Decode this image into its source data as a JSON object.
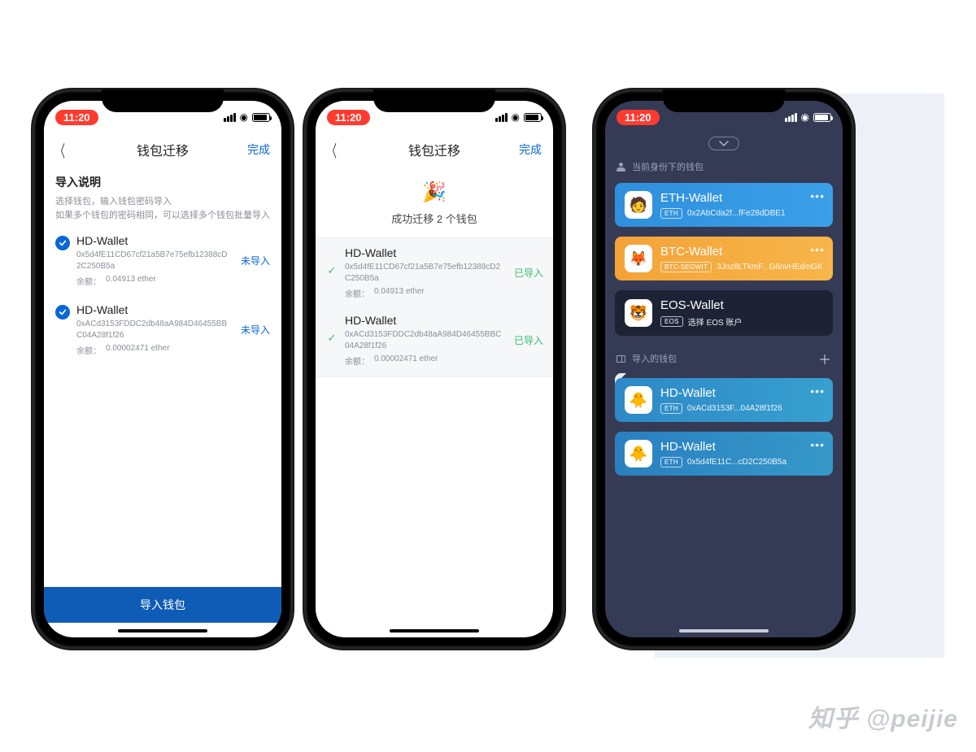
{
  "status_time": "11:20",
  "screen1": {
    "nav_title": "钱包迁移",
    "nav_done": "完成",
    "instr_title": "导入说明",
    "instr_line1": "选择钱包，输入钱包密码导入",
    "instr_line2": "如果多个钱包的密码相同，可以选择多个钱包批量导入",
    "status_not_imported": "未导入",
    "wallets": [
      {
        "name": "HD-Wallet",
        "addr": "0x5d4fE11CD67cf21a5B7e75efb12388cD2C250B5a",
        "balance_label": "余额：",
        "balance_value": "0.04913 ether"
      },
      {
        "name": "HD-Wallet",
        "addr": "0xACd3153FDDC2db48aA984D46455BBC04A28f1f26",
        "balance_label": "余额：",
        "balance_value": "0.00002471 ether"
      }
    ],
    "import_btn": "导入钱包"
  },
  "screen2": {
    "nav_title": "钱包迁移",
    "nav_done": "完成",
    "success_text": "成功迁移 2 个钱包",
    "success_emoji": "🎉",
    "status_imported": "已导入",
    "wallets": [
      {
        "name": "HD-Wallet",
        "addr": "0x5d4fE11CD67cf21a5B7e75efb12388cD2C250B5a",
        "balance_label": "余额：",
        "balance_value": "0.04913 ether"
      },
      {
        "name": "HD-Wallet",
        "addr": "0xACd3153FDDC2db48aA984D46455BBC04A28f1f26",
        "balance_label": "余额：",
        "balance_value": "0.00002471 ether"
      }
    ]
  },
  "screen3": {
    "section_identity": "当前身份下的钱包",
    "section_imported": "导入的钱包",
    "identity_wallets": [
      {
        "name": "ETH-Wallet",
        "badge": "ETH",
        "addr": "0x2AbCda2f...fFe28dDBE1"
      },
      {
        "name": "BTC-Wallet",
        "badge": "BTC-SEGWIT",
        "addr": "3Jnz8LTkmF...G6nvHEdmGK"
      },
      {
        "name": "EOS-Wallet",
        "badge": "EOS",
        "addr": "选择 EOS 账户"
      }
    ],
    "imported_wallets": [
      {
        "name": "HD-Wallet",
        "badge": "ETH",
        "addr": "0xACd3153F...04A28f1f26"
      },
      {
        "name": "HD-Wallet",
        "badge": "ETH",
        "addr": "0x5d4fE11C...cD2C250B5a"
      }
    ]
  },
  "watermark": "知乎 @peijie"
}
